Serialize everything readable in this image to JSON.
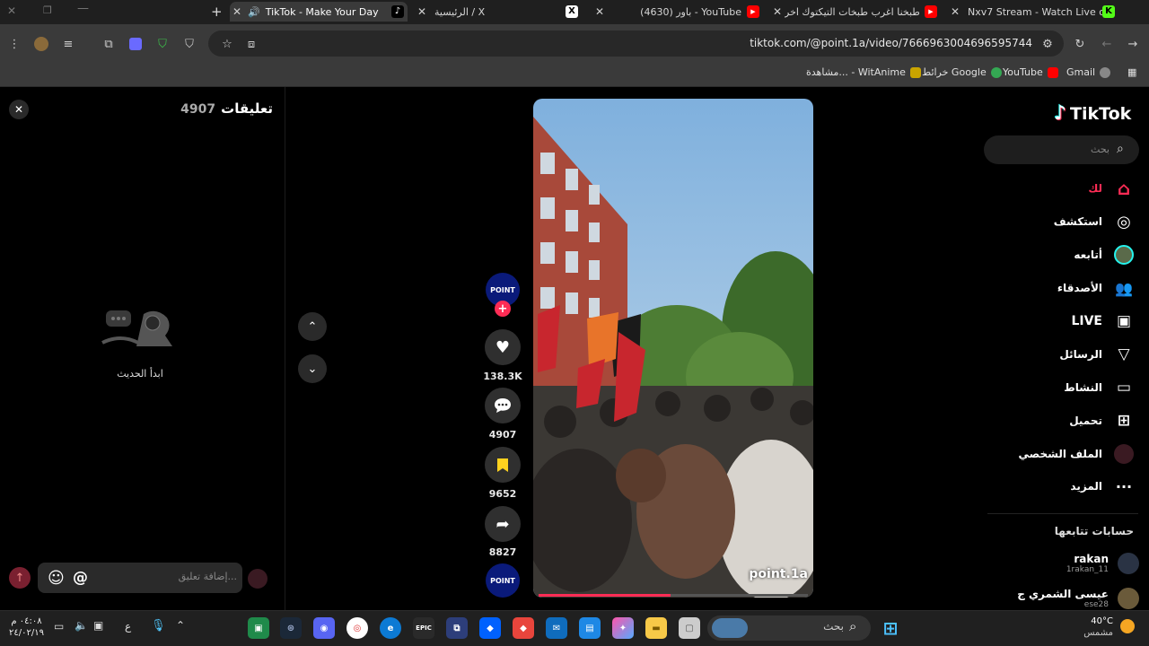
{
  "browser": {
    "tabs": [
      {
        "title": "TikTok - Make Your Day"
      },
      {
        "title": "الرئيسية / X"
      },
      {
        "title": "(4630) باور - YouTube"
      },
      {
        "title": "طبخنا اغرب طبخات التيكتوك اخر"
      },
      {
        "title": "Nxv7 Stream - Watch Live on K"
      }
    ],
    "url": "tiktok.com/@point.1a/video/7666963004696595744",
    "bookmarks": [
      "Gmail",
      "YouTube",
      "خرائط Google",
      "مشاهدة... - WitAnime"
    ]
  },
  "tiktok": {
    "logo": "TikTok",
    "search_placeholder": "بحث",
    "nav": [
      {
        "label": "لك",
        "icon": "home-icon"
      },
      {
        "label": "استكشف",
        "icon": "compass-icon"
      },
      {
        "label": "أتابعه",
        "icon": "following-avatar"
      },
      {
        "label": "الأصدقاء",
        "icon": "friends-icon"
      },
      {
        "label": "LIVE",
        "icon": "live-icon"
      },
      {
        "label": "الرسائل",
        "icon": "send-icon"
      },
      {
        "label": "النشاط",
        "icon": "activity-icon"
      },
      {
        "label": "تحميل",
        "icon": "upload-icon"
      },
      {
        "label": "الملف الشخصي",
        "icon": "profile-icon"
      },
      {
        "label": "المزيد",
        "icon": "more-icon"
      }
    ],
    "following_header": "حسابات تتابعها",
    "following": [
      {
        "name": "rakan",
        "handle": "1rakan_11"
      },
      {
        "name": "عيسى الشمري ج",
        "handle": "ese28"
      }
    ],
    "video": {
      "watermark": "point.1a",
      "progress": 0.49,
      "author_badge": "POINT",
      "likes": "138.3K",
      "comments": "4907",
      "saves": "9652",
      "shares": "8827"
    },
    "comments_panel": {
      "title": "تعليقات",
      "count": "4907",
      "empty_text": "ابدأ الحديث",
      "input_placeholder": "إضافة تعليق...",
      "mention_symbol": "@"
    }
  },
  "taskbar": {
    "search_placeholder": "بحث",
    "weather_temp": "40°C",
    "weather_desc": "مشمس",
    "time": "٠٤:٠٨ م",
    "date": "٢٤/٠٢/١٩",
    "lang": "ع"
  }
}
